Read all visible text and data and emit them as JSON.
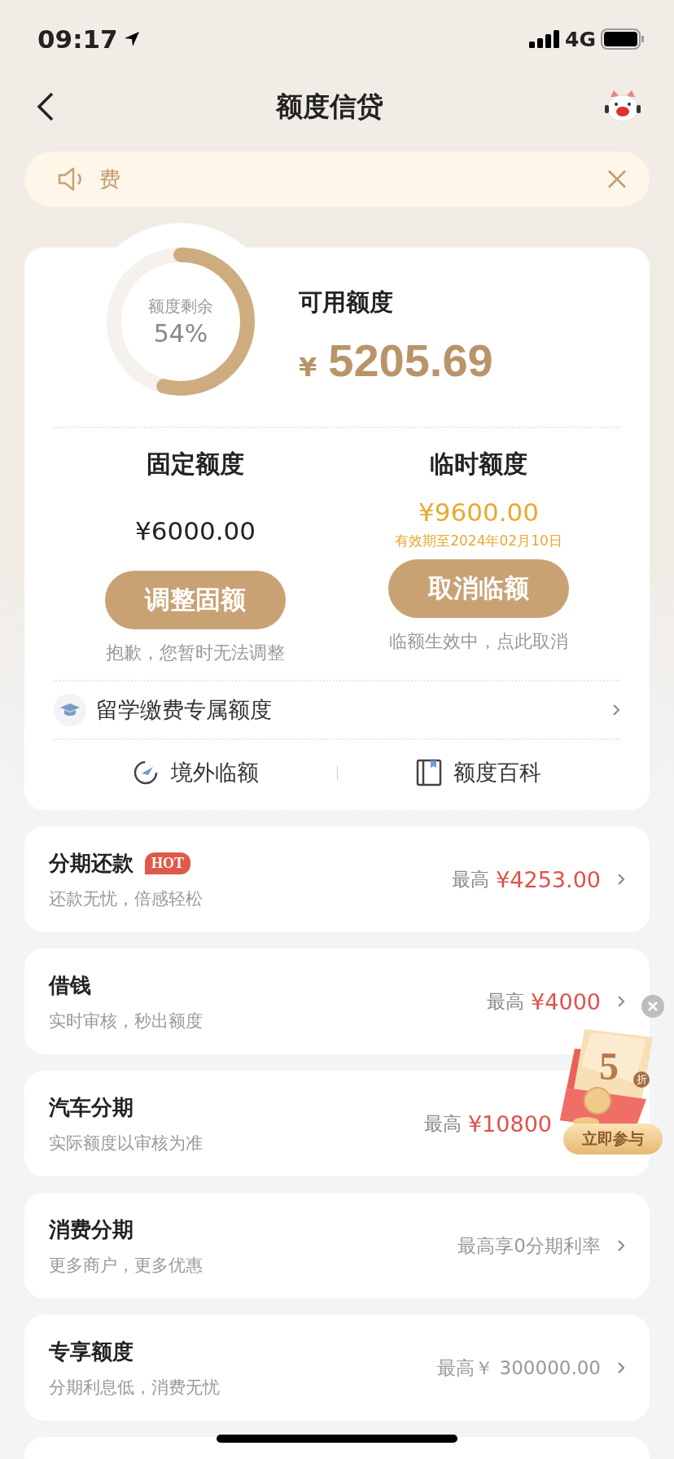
{
  "status_bar": {
    "time": "09:17",
    "network": "4G"
  },
  "nav": {
    "title": "额度信贷"
  },
  "notice": {
    "text": "费"
  },
  "credit": {
    "ring_label": "额度剩余",
    "ring_percent": "54%",
    "available_label": "可用额度",
    "currency": "¥",
    "available_amount": "5205.69",
    "columns": [
      {
        "title": "固定额度",
        "amount": "¥6000.00",
        "highlight": false,
        "button": "调整固额",
        "hint": "抱歉，您暂时无法调整"
      },
      {
        "title": "临时额度",
        "amount": "¥9600.00",
        "highlight": true,
        "expiry": "有效期至2024年02月10日",
        "button": "取消临额",
        "hint": "临额生效中，点此取消"
      }
    ],
    "study_link": "留学缴费专属额度",
    "shortcuts": [
      {
        "kind": "overseas",
        "label": "境外临额"
      },
      {
        "kind": "wiki",
        "label": "额度百科"
      }
    ]
  },
  "products": [
    {
      "title": "分期还款",
      "badge": "HOT",
      "subtitle": "还款无忧，倍感轻松",
      "kind": "amount",
      "prefix": "最高",
      "value": "¥4253.00",
      "chevron": true
    },
    {
      "title": "借钱",
      "subtitle": "实时审核，秒出额度",
      "kind": "amount",
      "prefix": "最高",
      "value": "¥4000",
      "chevron": true
    },
    {
      "title": "汽车分期",
      "subtitle": "实际额度以审核为准",
      "kind": "amount",
      "prefix": "最高",
      "value": "¥10800",
      "chevron": false
    },
    {
      "title": "消费分期",
      "subtitle": "更多商户，更多优惠",
      "kind": "text",
      "value": "最高享0分期利率",
      "chevron": true
    },
    {
      "title": "专享额度",
      "subtitle": "分期利息低，消费无忧",
      "kind": "text",
      "value": "最高￥ 300000.00",
      "chevron": true
    }
  ],
  "promo": {
    "discount": "5",
    "unit": "折",
    "button": "立即参与"
  }
}
